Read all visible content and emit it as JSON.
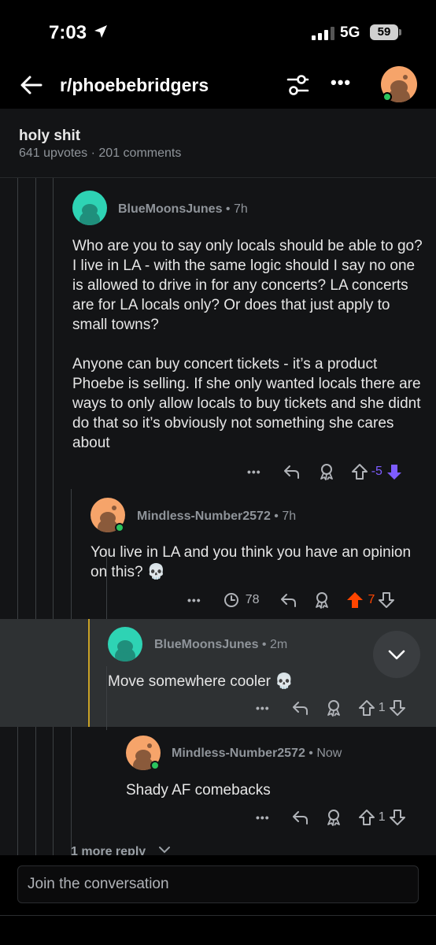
{
  "status": {
    "time": "7:03",
    "network": "5G",
    "battery": "59"
  },
  "header": {
    "subreddit": "r/phoebebridgers"
  },
  "post": {
    "title": "holy shit",
    "meta": "641 upvotes · 201 comments"
  },
  "comments": [
    {
      "username": "BlueMoonsJunes",
      "time": "7h",
      "body_p1": "Who are you to say only locals should be able to go? I live in LA  - with the same logic should I say no one is allowed to drive in for any concerts? LA concerts are for LA locals only? Or does that just apply to small towns?",
      "body_p2": "Anyone can buy concert tickets - it’s a product Phoebe is selling. If she only wanted locals there are ways to only allow locals to buy tickets and she didnt do that so it’s obviously not something she cares about",
      "score": "-5"
    },
    {
      "username": "Mindless-Number2572",
      "time": "7h",
      "body": "You live in LA and you think you have an opinion on this? 💀",
      "awards": "78",
      "score": "7"
    },
    {
      "username": "BlueMoonsJunes",
      "time": "2m",
      "body": "Move somewhere cooler 💀",
      "score": "1"
    },
    {
      "username": "Mindless-Number2572",
      "time": "Now",
      "body": "Shady AF comebacks",
      "score": "1"
    }
  ],
  "more_replies": "1 more reply",
  "footer": {
    "placeholder": "Join the conversation"
  },
  "colors": {
    "upvote_active": "#ff4500",
    "downvote_active": "#7d5cff",
    "online": "#2bc45e",
    "thread_gold": "#c9a227"
  }
}
